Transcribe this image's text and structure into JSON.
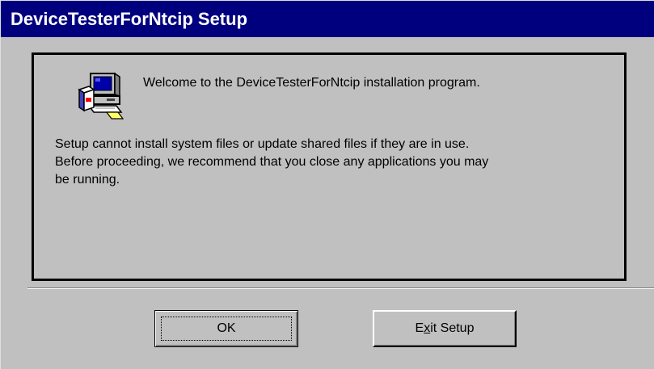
{
  "window": {
    "title": "DeviceTesterForNtcip Setup"
  },
  "content": {
    "icon": "setup-computer-icon",
    "welcome": "Welcome to the DeviceTesterForNtcip installation program.",
    "body": "Setup cannot install system files or update shared files if they are in use.\nBefore proceeding, we recommend that you close any applications you may\nbe running."
  },
  "buttons": {
    "ok_label": "OK",
    "exit_label_pre": "E",
    "exit_label_accel": "x",
    "exit_label_post": "it Setup"
  },
  "colors": {
    "title_bar": "#00007f",
    "face": "#c0c0c0"
  }
}
